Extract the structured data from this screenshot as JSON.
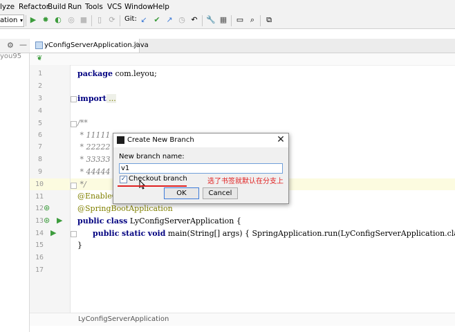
{
  "menu": [
    "lyze",
    "Refactor",
    "Build",
    "Run",
    "Tools",
    "VCS",
    "Window",
    "Help"
  ],
  "toolbar": {
    "config_label": "ation",
    "git_label": "Git:"
  },
  "project_pane": {
    "item": "you95"
  },
  "editor": {
    "tab_title": "yConfigServerApplication.java",
    "line_numbers": [
      "1",
      "2",
      "3",
      "4",
      "5",
      "6",
      "7",
      "8",
      "9",
      "10",
      "11",
      "12",
      "13",
      "14",
      "15",
      "16",
      "17"
    ],
    "lines": {
      "l1_kw": "package",
      "l1_rest": " com.leyou;",
      "l3_kw": "import",
      "l3_rest": " ...",
      "l7": "/**",
      "l8": " * 11111",
      "l9": " * 22222",
      "l10": " * 33333",
      "l11": " * 44444",
      "l12": " */",
      "l13": "@EnableCo",
      "l14": "@SpringBootApplication",
      "l15_kw1": "public",
      "l15_kw2": "class",
      "l15_rest": " LyConfigServerApplication {",
      "l16_kw1": "public",
      "l16_kw2": "static",
      "l16_kw3": "void",
      "l16_rest": " main(String[] args) { SpringApplication.run(LyConfigServerApplication.clas",
      "l17": "}"
    },
    "bottom_breadcrumb": "LyConfigServerApplication"
  },
  "dialog": {
    "title": "Create New Branch",
    "label": "New branch name:",
    "input_value": "v1",
    "checkbox_label": "Checkout branch",
    "checkbox_checked": true,
    "ok_label": "OK",
    "cancel_label": "Cancel"
  },
  "annotation": {
    "note": "选了书签就默认在分支上",
    "color": "#e02020"
  }
}
